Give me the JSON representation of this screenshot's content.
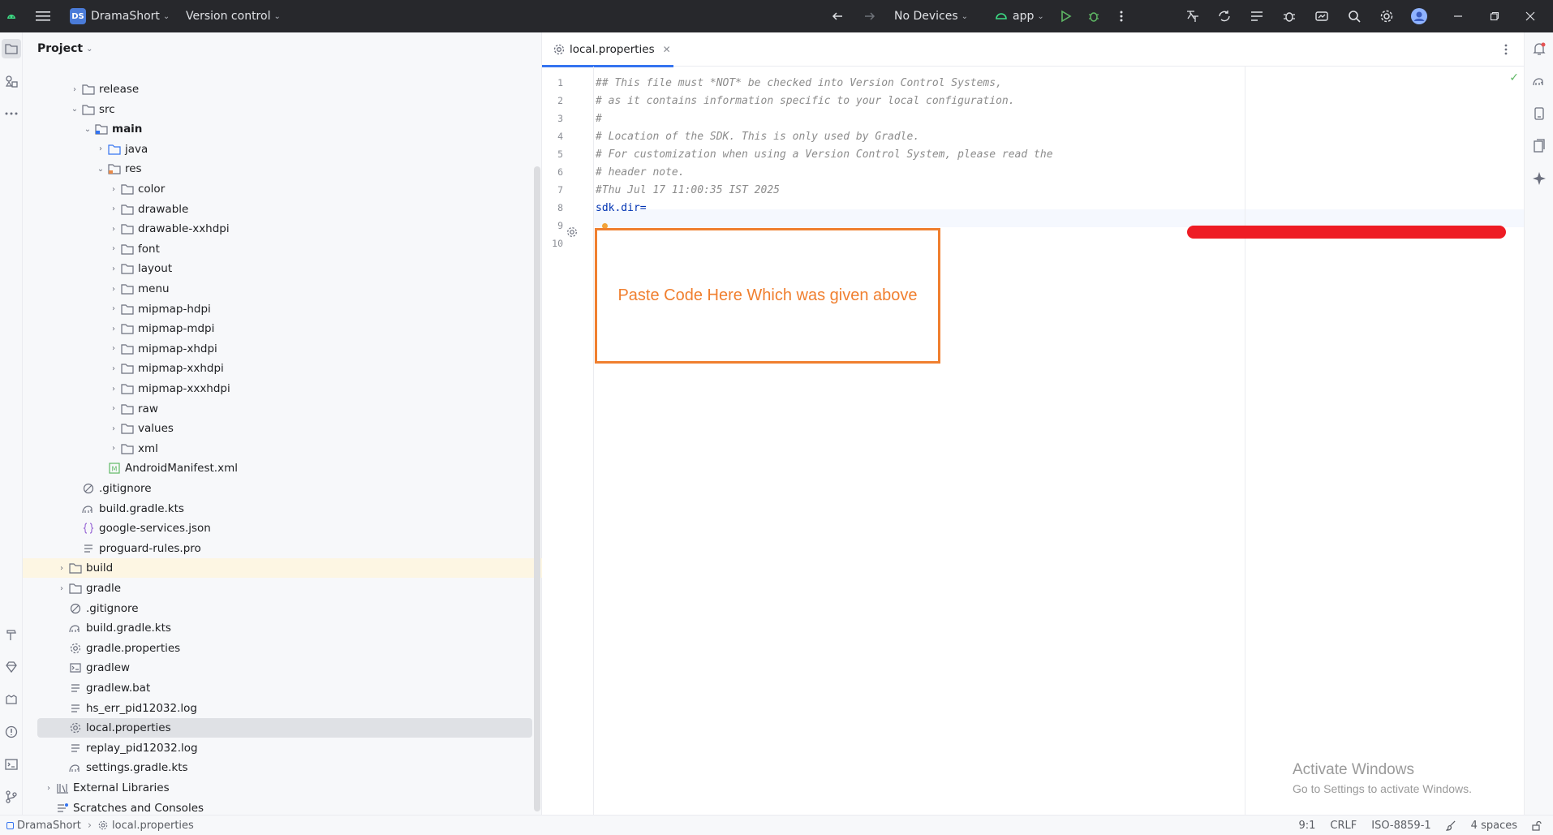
{
  "titlebar": {
    "project_badge": "DS",
    "project_name": "DramaShort",
    "vcs_label": "Version control",
    "device": "No Devices",
    "run_config": "app"
  },
  "project_panel": {
    "title": "Project",
    "tree": [
      {
        "label": "release",
        "depth": 3,
        "type": "folder",
        "chev": "›"
      },
      {
        "label": "src",
        "depth": 3,
        "type": "folder",
        "chev": "⌄"
      },
      {
        "label": "main",
        "depth": 4,
        "type": "folder-src",
        "chev": "⌄",
        "bold": true
      },
      {
        "label": "java",
        "depth": 5,
        "type": "folder-blue",
        "chev": "›"
      },
      {
        "label": "res",
        "depth": 5,
        "type": "folder-res",
        "chev": "⌄"
      },
      {
        "label": "color",
        "depth": 6,
        "type": "folder",
        "chev": "›"
      },
      {
        "label": "drawable",
        "depth": 6,
        "type": "folder",
        "chev": "›"
      },
      {
        "label": "drawable-xxhdpi",
        "depth": 6,
        "type": "folder",
        "chev": "›"
      },
      {
        "label": "font",
        "depth": 6,
        "type": "folder",
        "chev": "›"
      },
      {
        "label": "layout",
        "depth": 6,
        "type": "folder",
        "chev": "›"
      },
      {
        "label": "menu",
        "depth": 6,
        "type": "folder",
        "chev": "›"
      },
      {
        "label": "mipmap-hdpi",
        "depth": 6,
        "type": "folder",
        "chev": "›"
      },
      {
        "label": "mipmap-mdpi",
        "depth": 6,
        "type": "folder",
        "chev": "›"
      },
      {
        "label": "mipmap-xhdpi",
        "depth": 6,
        "type": "folder",
        "chev": "›"
      },
      {
        "label": "mipmap-xxhdpi",
        "depth": 6,
        "type": "folder",
        "chev": "›"
      },
      {
        "label": "mipmap-xxxhdpi",
        "depth": 6,
        "type": "folder",
        "chev": "›"
      },
      {
        "label": "raw",
        "depth": 6,
        "type": "folder",
        "chev": "›"
      },
      {
        "label": "values",
        "depth": 6,
        "type": "folder",
        "chev": "›"
      },
      {
        "label": "xml",
        "depth": 6,
        "type": "folder",
        "chev": "›"
      },
      {
        "label": "AndroidManifest.xml",
        "depth": 5,
        "type": "manifest",
        "chev": ""
      },
      {
        "label": ".gitignore",
        "depth": 3,
        "type": "ignore",
        "chev": ""
      },
      {
        "label": "build.gradle.kts",
        "depth": 3,
        "type": "gradle",
        "chev": ""
      },
      {
        "label": "google-services.json",
        "depth": 3,
        "type": "json",
        "chev": ""
      },
      {
        "label": "proguard-rules.pro",
        "depth": 3,
        "type": "text",
        "chev": ""
      },
      {
        "label": "build",
        "depth": 2,
        "type": "folder",
        "chev": "›",
        "highlight": true
      },
      {
        "label": "gradle",
        "depth": 2,
        "type": "folder",
        "chev": "›"
      },
      {
        "label": ".gitignore",
        "depth": 2,
        "type": "ignore",
        "chev": ""
      },
      {
        "label": "build.gradle.kts",
        "depth": 2,
        "type": "gradle",
        "chev": ""
      },
      {
        "label": "gradle.properties",
        "depth": 2,
        "type": "settings",
        "chev": ""
      },
      {
        "label": "gradlew",
        "depth": 2,
        "type": "terminal",
        "chev": ""
      },
      {
        "label": "gradlew.bat",
        "depth": 2,
        "type": "text",
        "chev": ""
      },
      {
        "label": "hs_err_pid12032.log",
        "depth": 2,
        "type": "text",
        "chev": ""
      },
      {
        "label": "local.properties",
        "depth": 2,
        "type": "settings",
        "chev": "",
        "selected": true
      },
      {
        "label": "replay_pid12032.log",
        "depth": 2,
        "type": "text",
        "chev": ""
      },
      {
        "label": "settings.gradle.kts",
        "depth": 2,
        "type": "gradle",
        "chev": ""
      },
      {
        "label": "External Libraries",
        "depth": 1,
        "type": "library",
        "chev": "›"
      },
      {
        "label": "Scratches and Consoles",
        "depth": 1,
        "type": "scratch",
        "chev": ""
      }
    ]
  },
  "editor": {
    "tab_label": "local.properties",
    "lines": [
      {
        "n": "1",
        "text": "## This file must *NOT* be checked into Version Control Systems,",
        "kind": "comment"
      },
      {
        "n": "2",
        "text": "# as it contains information specific to your local configuration.",
        "kind": "comment"
      },
      {
        "n": "3",
        "text": "#",
        "kind": "comment"
      },
      {
        "n": "4",
        "text": "# Location of the SDK. This is only used by Gradle.",
        "kind": "comment"
      },
      {
        "n": "5",
        "text": "# For customization when using a Version Control System, please read the",
        "kind": "comment"
      },
      {
        "n": "6",
        "text": "# header note.",
        "kind": "comment"
      },
      {
        "n": "7",
        "text": "#Thu Jul 17 11:00:35 IST 2025",
        "kind": "comment"
      },
      {
        "n": "8",
        "text": "sdk.dir=",
        "kind": "key"
      },
      {
        "n": "9",
        "text": "",
        "kind": "plain"
      },
      {
        "n": "10",
        "text": "",
        "kind": "plain"
      }
    ],
    "annotation": "Paste Code Here Which was given above"
  },
  "watermark": {
    "title": "Activate Windows",
    "subtitle": "Go to Settings to activate Windows."
  },
  "statusbar": {
    "project": "DramaShort",
    "file": "local.properties",
    "position": "9:1",
    "line_sep": "CRLF",
    "encoding": "ISO-8859-1",
    "indent": "4 spaces"
  },
  "colors": {
    "accent": "#3574f0",
    "annotation": "#f07f2f",
    "redaction": "#ee1c24"
  }
}
